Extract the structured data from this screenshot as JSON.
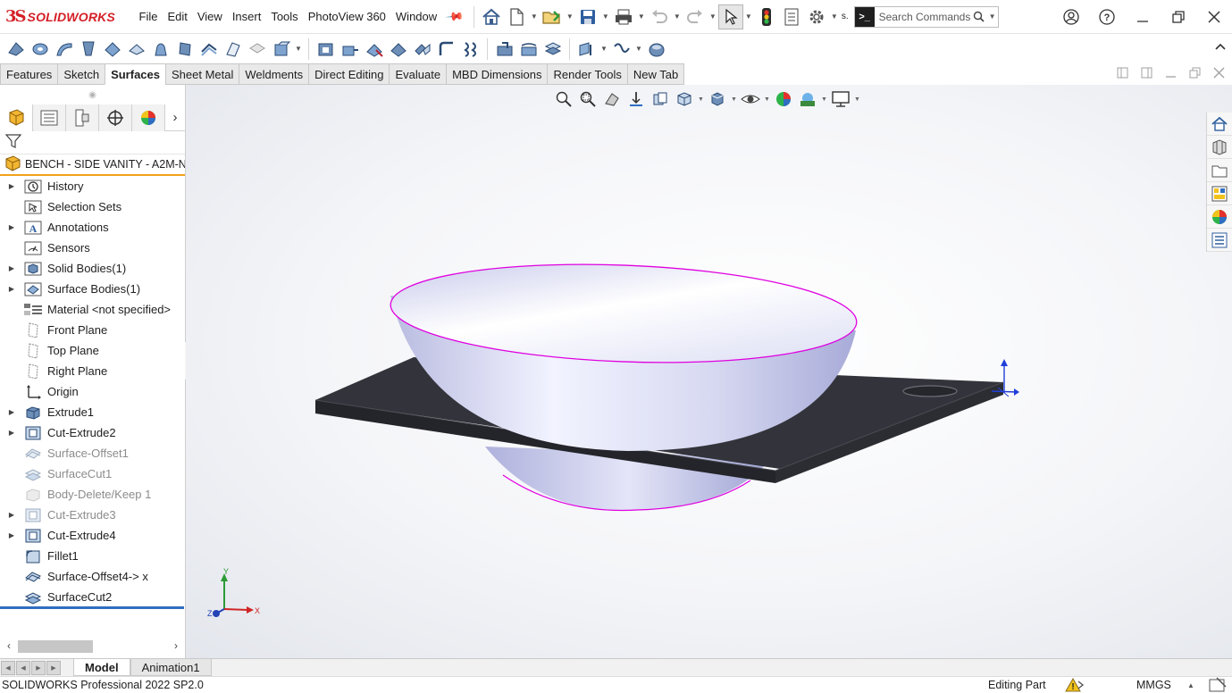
{
  "app": {
    "logo_mark": "3S",
    "logo_text": "SOLIDWORKS"
  },
  "menu": [
    "File",
    "Edit",
    "View",
    "Insert",
    "Tools",
    "PhotoView 360",
    "Window"
  ],
  "toolbar": {
    "overflow_label": "s.",
    "search_placeholder": "Search Commands"
  },
  "tabs": [
    {
      "label": "Features",
      "active": false
    },
    {
      "label": "Sketch",
      "active": false
    },
    {
      "label": "Surfaces",
      "active": true
    },
    {
      "label": "Sheet Metal",
      "active": false
    },
    {
      "label": "Weldments",
      "active": false
    },
    {
      "label": "Direct Editing",
      "active": false
    },
    {
      "label": "Evaluate",
      "active": false
    },
    {
      "label": "MBD Dimensions",
      "active": false
    },
    {
      "label": "Render Tools",
      "active": false
    },
    {
      "label": "New Tab",
      "active": false
    }
  ],
  "feature_tree": {
    "part_name": "BENCH - SIDE VANITY  - A2M-N",
    "items": [
      {
        "label": "History",
        "icon": "history-icon",
        "expandable": true,
        "suppressed": false
      },
      {
        "label": "Selection Sets",
        "icon": "selection-sets-icon",
        "expandable": false,
        "suppressed": false
      },
      {
        "label": "Annotations",
        "icon": "annotations-icon",
        "expandable": true,
        "suppressed": false
      },
      {
        "label": "Sensors",
        "icon": "sensors-icon",
        "expandable": false,
        "suppressed": false
      },
      {
        "label": "Solid Bodies(1)",
        "icon": "solid-bodies-icon",
        "expandable": true,
        "suppressed": false
      },
      {
        "label": "Surface Bodies(1)",
        "icon": "surface-bodies-icon",
        "expandable": true,
        "suppressed": false
      },
      {
        "label": "Material <not specified>",
        "icon": "material-icon",
        "expandable": false,
        "suppressed": false
      },
      {
        "label": "Front Plane",
        "icon": "plane-icon",
        "expandable": false,
        "suppressed": false
      },
      {
        "label": "Top Plane",
        "icon": "plane-icon",
        "expandable": false,
        "suppressed": false
      },
      {
        "label": "Right Plane",
        "icon": "plane-icon",
        "expandable": false,
        "suppressed": false
      },
      {
        "label": "Origin",
        "icon": "origin-icon",
        "expandable": false,
        "suppressed": false
      },
      {
        "label": "Extrude1",
        "icon": "extrude-icon",
        "expandable": true,
        "suppressed": false
      },
      {
        "label": "Cut-Extrude2",
        "icon": "cut-extrude-icon",
        "expandable": true,
        "suppressed": false
      },
      {
        "label": "Surface-Offset1",
        "icon": "surface-offset-icon",
        "expandable": false,
        "suppressed": true
      },
      {
        "label": "SurfaceCut1",
        "icon": "surface-cut-icon",
        "expandable": false,
        "suppressed": true
      },
      {
        "label": "Body-Delete/Keep 1",
        "icon": "body-delete-icon",
        "expandable": false,
        "suppressed": true
      },
      {
        "label": "Cut-Extrude3",
        "icon": "cut-extrude-icon",
        "expandable": true,
        "suppressed": true
      },
      {
        "label": "Cut-Extrude4",
        "icon": "cut-extrude-icon",
        "expandable": true,
        "suppressed": false
      },
      {
        "label": "Fillet1",
        "icon": "fillet-icon",
        "expandable": false,
        "suppressed": false
      },
      {
        "label": "Surface-Offset4-> x",
        "icon": "surface-offset-icon",
        "expandable": false,
        "suppressed": false
      },
      {
        "label": "SurfaceCut2",
        "icon": "surface-cut-icon",
        "expandable": false,
        "suppressed": false
      }
    ]
  },
  "triad": {
    "x": "X",
    "y": "Y",
    "z": "Z"
  },
  "model_tabs": [
    {
      "label": "Model",
      "active": true
    },
    {
      "label": "Animation1",
      "active": false
    }
  ],
  "status": {
    "product": "SOLIDWORKS Professional 2022 SP2.0",
    "mode": "Editing Part",
    "units": "MMGS"
  },
  "colors": {
    "brand_red": "#d41f26",
    "active_tab_underline": "#f0a21a",
    "rollback_bar": "#2f6ec2",
    "sink_edge": "#e000e0",
    "board": "#33343b"
  }
}
